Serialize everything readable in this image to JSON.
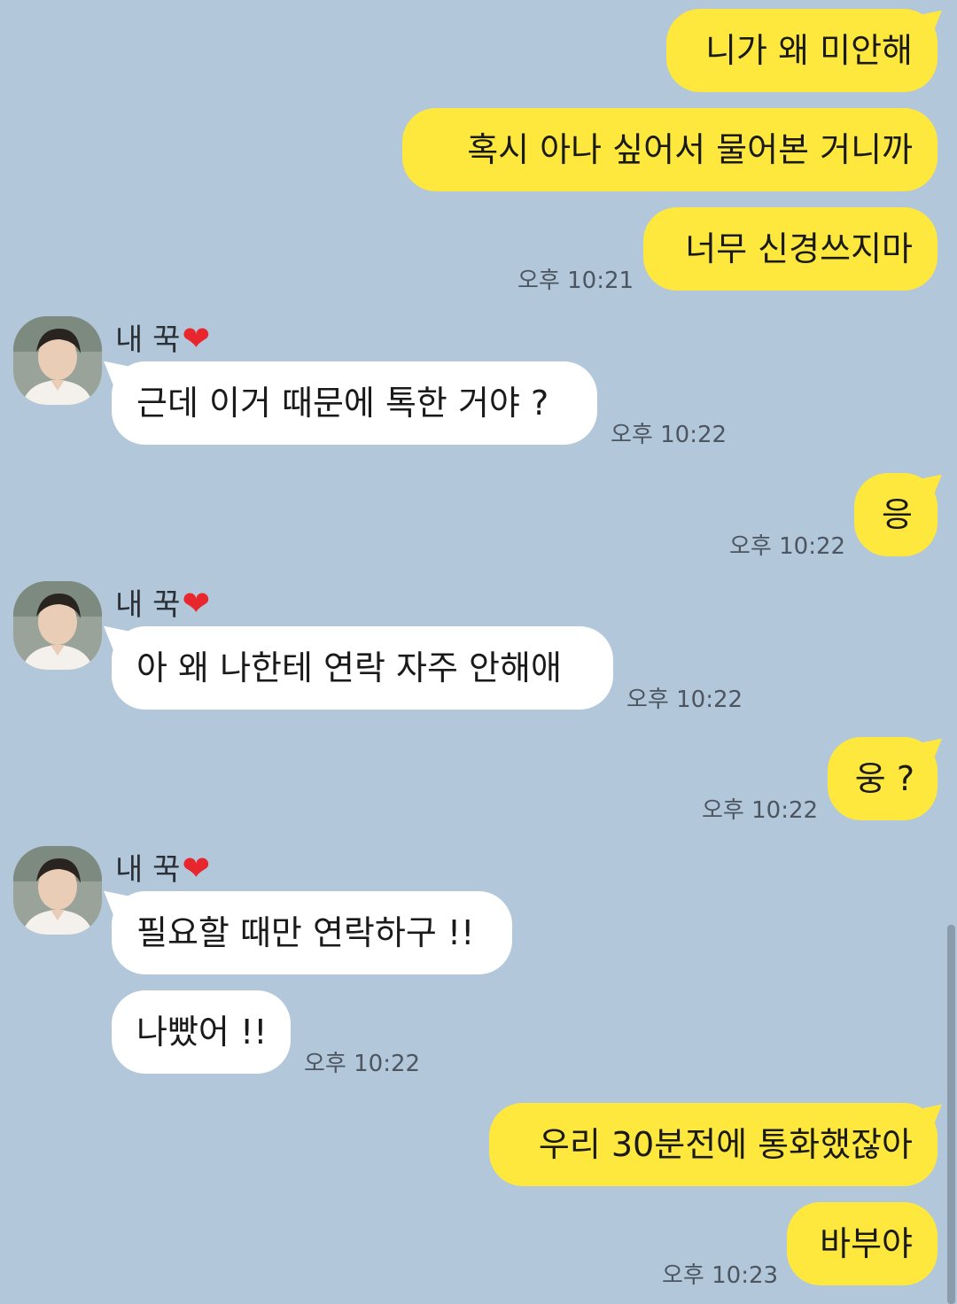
{
  "contact": {
    "name": "내 꾹",
    "heart": "❤"
  },
  "messages": [
    {
      "from": "me",
      "text": "니가 왜 미안해"
    },
    {
      "from": "me",
      "text": "혹시 아나 싶어서 물어본 거니까"
    },
    {
      "from": "me",
      "text": "너무 신경쓰지마",
      "time": "오후 10:21"
    },
    {
      "from": "them",
      "text": "근데 이거 때문에 톡한 거야 ?",
      "time": "오후 10:22"
    },
    {
      "from": "me",
      "text": "응",
      "time": "오후 10:22"
    },
    {
      "from": "them",
      "text": "아 왜 나한테 연락 자주 안해애",
      "time": "오후 10:22"
    },
    {
      "from": "me",
      "text": "웅 ?",
      "time": "오후 10:22"
    },
    {
      "from": "them",
      "text": "필요할 때만 연락하구 !!"
    },
    {
      "from": "them",
      "text": "나빴어 !!",
      "time": "오후 10:22"
    },
    {
      "from": "me",
      "text": "우리 30분전에 통화했잖아"
    },
    {
      "from": "me",
      "text": "바부야",
      "time": "오후 10:23"
    }
  ],
  "colors": {
    "background": "#b2c7da",
    "my_bubble": "#fee83e",
    "their_bubble": "#ffffff",
    "heart": "#e8262e"
  },
  "icons": {
    "avatar": "profile-photo",
    "heart": "red-heart-emoji"
  }
}
